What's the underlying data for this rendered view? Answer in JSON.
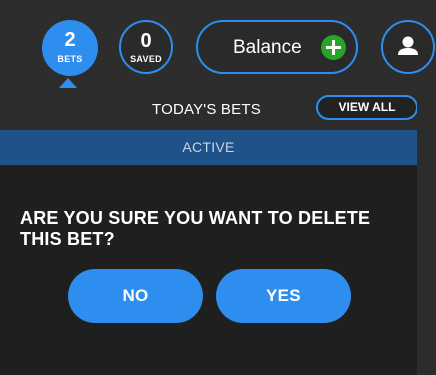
{
  "header": {
    "bets": {
      "count": "2",
      "label": "BETS"
    },
    "saved": {
      "count": "0",
      "label": "SAVED"
    },
    "balance": {
      "label": "Balance"
    }
  },
  "panel": {
    "title": "TODAY'S BETS",
    "view_all_label": "VIEW ALL",
    "active_tab": "ACTIVE"
  },
  "dialog": {
    "question": "ARE YOU SURE YOU WANT TO DELETE THIS BET?",
    "no_label": "NO",
    "yes_label": "YES"
  },
  "colors": {
    "accent": "#2d8ef0",
    "add_button": "#28a428",
    "active_tab": "#1e5288"
  },
  "icons": {
    "add": "plus-circle-icon",
    "user": "user-icon",
    "pointer": "caret-up-icon"
  }
}
